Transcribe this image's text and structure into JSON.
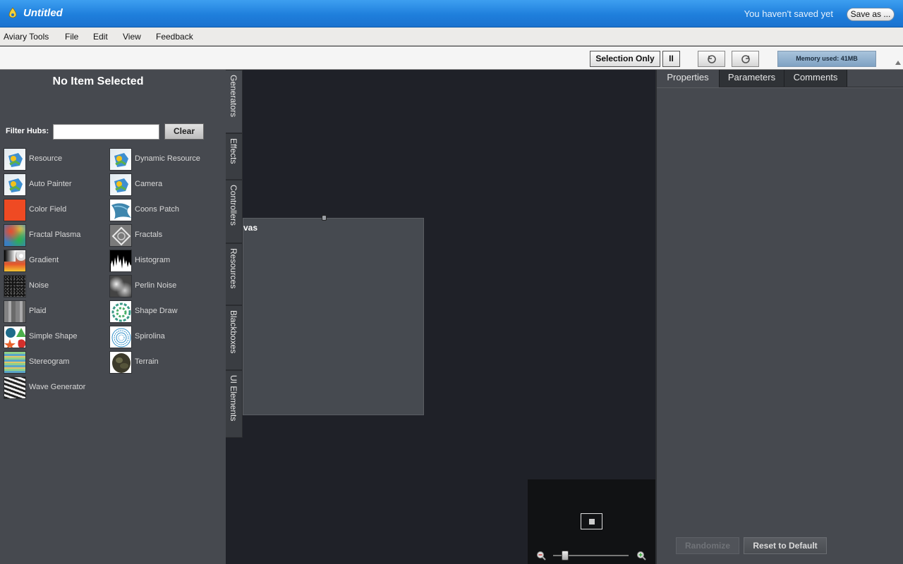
{
  "window": {
    "title": "Untitled",
    "save_status": "You haven't saved yet",
    "save_as_label": "Save as ..."
  },
  "menu": [
    "Aviary Tools",
    "File",
    "Edit",
    "View",
    "Feedback"
  ],
  "toolbar": {
    "selection_only_label": "Selection Only",
    "pause_label": "II",
    "memory_label": "Memory used: 41MB"
  },
  "left_panel": {
    "title": "No Item Selected",
    "filter_label": "Filter Hubs:",
    "filter_value": "",
    "clear_label": "Clear",
    "hubs_col1": [
      "Resource",
      "Auto Painter",
      "Color Field",
      "Fractal Plasma",
      "Gradient",
      "Noise",
      "Plaid",
      "Simple Shape",
      "Stereogram",
      "Wave Generator"
    ],
    "hubs_col2": [
      "Dynamic Resource",
      "Camera",
      "Coons Patch",
      "Fractals",
      "Histogram",
      "Perlin Noise",
      "Shape Draw",
      "Spirolina",
      "Terrain"
    ]
  },
  "vertical_tabs": [
    "Generators",
    "Effects",
    "Controllers",
    "Resources",
    "Blackboxes",
    "UI Elements"
  ],
  "canvas": {
    "node_label": "vas"
  },
  "right_panel": {
    "tabs": [
      "Properties",
      "Parameters",
      "Comments"
    ],
    "randomize_label": "Randomize",
    "reset_label": "Reset to Default"
  }
}
